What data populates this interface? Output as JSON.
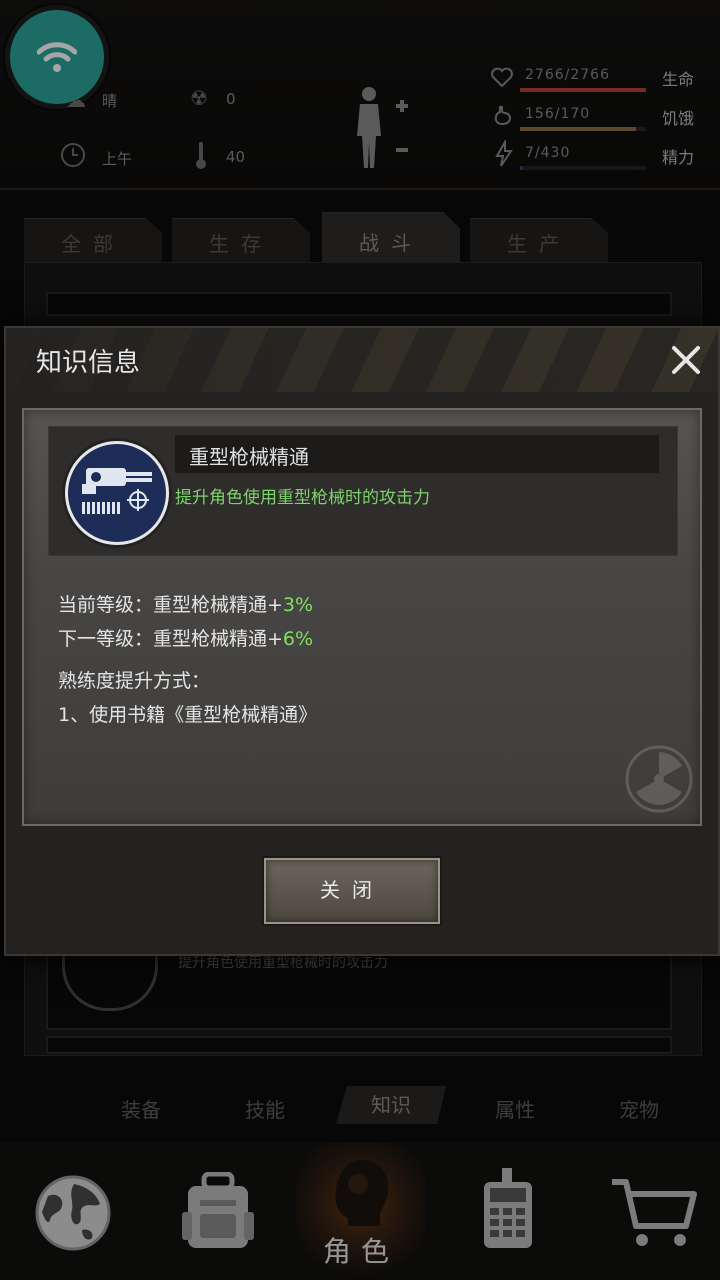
{
  "status": {
    "weather": "晴",
    "radiation_value": "0",
    "time_of_day": "上午",
    "temperature": "40",
    "vitals": [
      {
        "value": "2766/2766",
        "label": "生命",
        "percent": 100,
        "color": "#b3423a"
      },
      {
        "value": "156/170",
        "label": "饥饿",
        "percent": 92,
        "color": "#8a6f3f"
      },
      {
        "value": "7/430",
        "label": "精力",
        "percent": 2,
        "color": "#3b3f66"
      }
    ]
  },
  "background": {
    "tabs": [
      "全部",
      "生存",
      "战斗",
      "生产"
    ],
    "active_tab": "战斗",
    "peek_desc": "提升角色使用重型枪械时的攻击力"
  },
  "modal": {
    "title": "知识信息",
    "skill": {
      "name": "重型枪械精通",
      "description": "提升角色使用重型枪械时的攻击力"
    },
    "current_level_prefix": "当前等级：重型枪械精通+",
    "current_level_value": "3%",
    "next_level_prefix": "下一等级：重型枪械精通+",
    "next_level_value": "6%",
    "method_title": "熟练度提升方式：",
    "method_1": "1、使用书籍《重型枪械精通》",
    "close_label": "关闭"
  },
  "subtabs": [
    "装备",
    "技能",
    "知识",
    "属性",
    "宠物"
  ],
  "active_subtab": "知识",
  "nav": {
    "active_label": "角色"
  }
}
